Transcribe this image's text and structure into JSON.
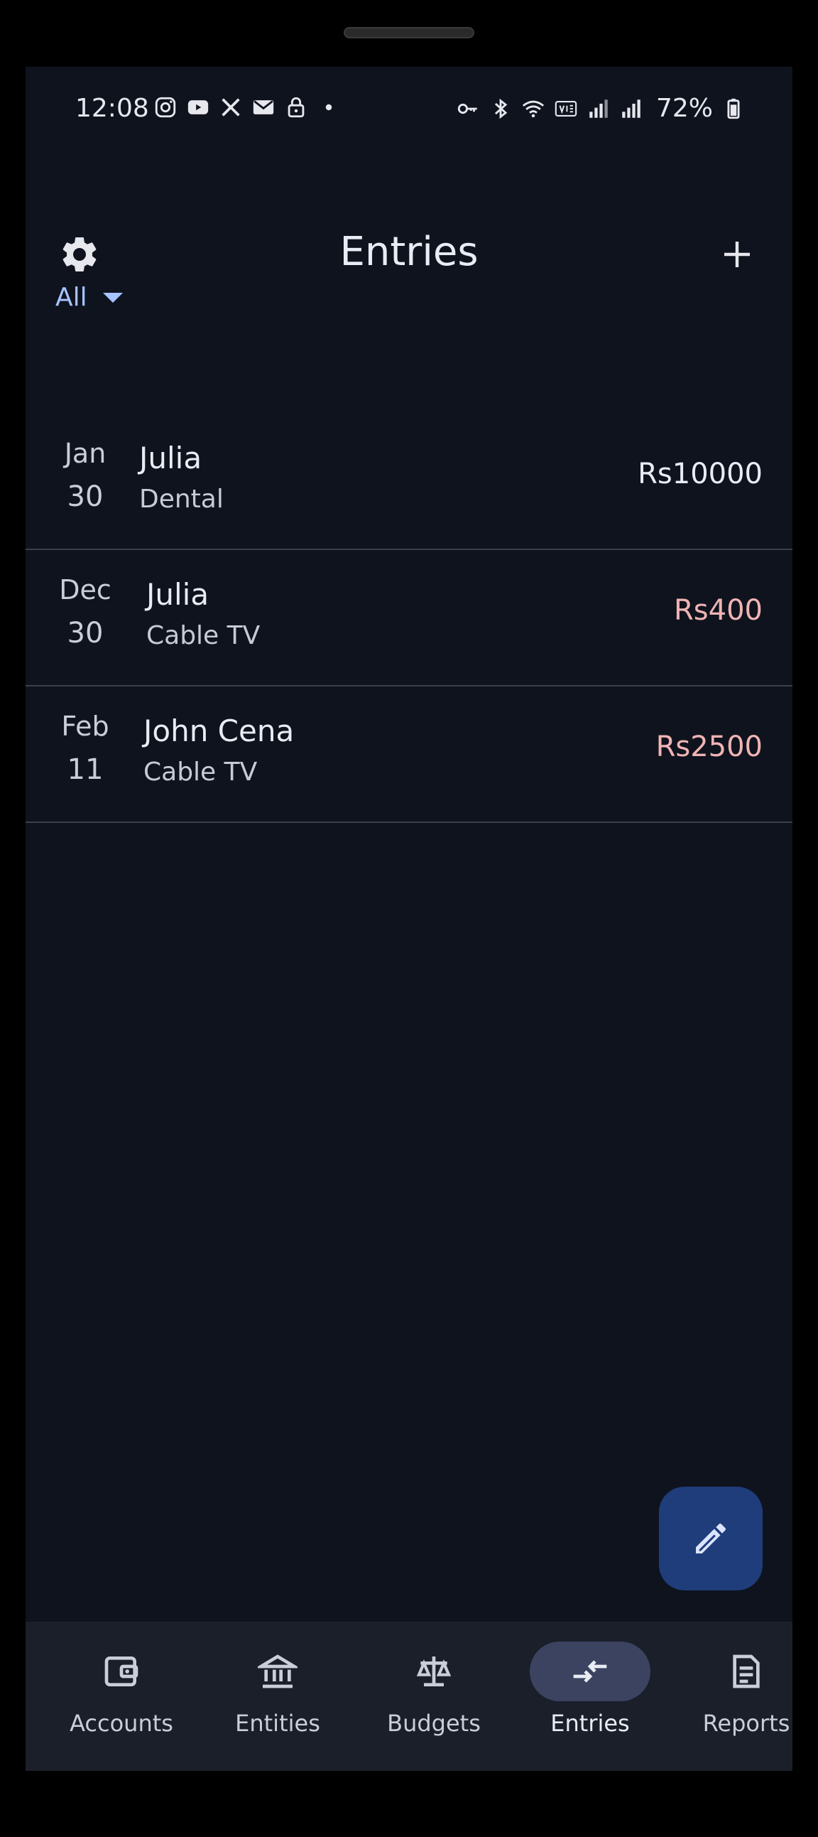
{
  "status_bar": {
    "time": "12:08",
    "battery": "72%",
    "left_icons": [
      "instagram-icon",
      "youtube-icon",
      "x-icon",
      "mail-icon",
      "lock-icon",
      "dot-icon"
    ],
    "right_icons": [
      "key-icon",
      "bluetooth-icon",
      "wifi-icon",
      "volte-icon",
      "signal-icon",
      "signal-icon",
      "battery-icon"
    ]
  },
  "top_bar": {
    "title": "Entries",
    "left_icon": "gear-icon",
    "right_icon": "plus-icon"
  },
  "filter": {
    "label": "All",
    "icon": "caret-down-icon"
  },
  "entries": [
    {
      "month": "Jan",
      "day": "30",
      "name": "Julia",
      "category": "Dental",
      "amount": "Rs10000",
      "amount_color": "#e9ecf3"
    },
    {
      "month": "Dec",
      "day": "30",
      "name": "Julia",
      "category": "Cable TV",
      "amount": "Rs400",
      "amount_color": "#f0b4b4"
    },
    {
      "month": "Feb",
      "day": "11",
      "name": "John Cena",
      "category": "Cable TV",
      "amount": "Rs2500",
      "amount_color": "#f0b4b4"
    }
  ],
  "fab": {
    "icon": "pencil-icon"
  },
  "bottom_nav": {
    "items": [
      {
        "label": "Accounts",
        "icon": "wallet-icon"
      },
      {
        "label": "Entities",
        "icon": "bank-icon"
      },
      {
        "label": "Budgets",
        "icon": "scale-icon"
      },
      {
        "label": "Entries",
        "icon": "swap-icon",
        "active": true
      },
      {
        "label": "Reports",
        "icon": "document-icon"
      }
    ]
  },
  "colors": {
    "background": "#0f131e",
    "nav_background": "#1b1f2a",
    "accent": "#a7c4ff",
    "fab": "#1f3d7a",
    "active_pill": "#3b4361",
    "divider": "#3a404b",
    "expense": "#f0b4b4"
  }
}
